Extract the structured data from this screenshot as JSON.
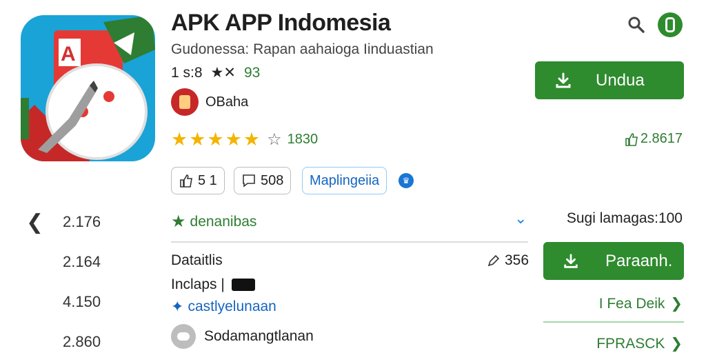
{
  "app": {
    "title": "APK APP Indomesia",
    "subtitle": "Gudonessa: Rapan aahaioga  Iinduastian",
    "meta_size": "1 s:8",
    "meta_rating": "93",
    "developer": "OBaha",
    "stars_count": "1830",
    "right_stat": "2.8617"
  },
  "chips": [
    {
      "value": "5 1"
    },
    {
      "value": "508"
    },
    {
      "value": "Maplingeiia"
    }
  ],
  "buttons": {
    "download": "Undua",
    "paranaha": "Paraanh."
  },
  "left_numbers": [
    "2.176",
    "2.164",
    "4.150",
    "2.860"
  ],
  "middle": {
    "category": "denanibas",
    "details": "Dataitlis",
    "pen_count": "356",
    "includes": "Inclaps |",
    "link": "castlyelunaan",
    "developer2": "Sodamangtlanan"
  },
  "right": {
    "sign_language": "Sugi lamagas:100",
    "link1": "I Fea Deik",
    "link2": "FPRASCK"
  },
  "colors": {
    "accent_green": "#2e8b2e",
    "link_blue": "#1565c0",
    "star_gold": "#f4b400"
  }
}
